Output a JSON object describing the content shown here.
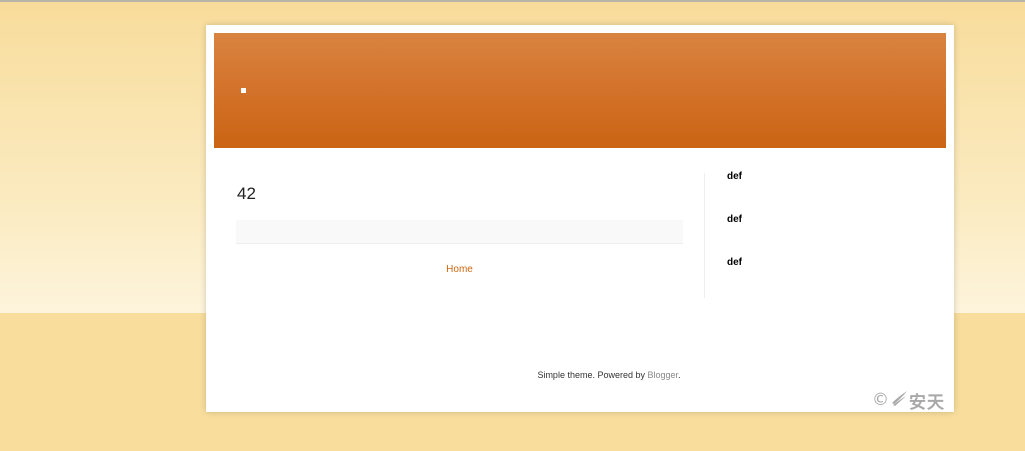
{
  "blog": {
    "header_mark": "",
    "post_title": "42",
    "home_link": "Home"
  },
  "sidebar": {
    "widgets": [
      {
        "title": "def"
      },
      {
        "title": "def"
      },
      {
        "title": "def"
      }
    ]
  },
  "footer": {
    "attribution_prefix": "Simple theme. Powered by ",
    "attribution_link": "Blogger",
    "attribution_suffix": "."
  },
  "watermark": {
    "copyright_symbol": "©",
    "text": "安天",
    "icon": "wing-logo-icon"
  },
  "colors": {
    "header_top": "#d88441",
    "header_bottom": "#cb6413",
    "link": "#cc6611",
    "page_background": "#f8dd9c"
  }
}
